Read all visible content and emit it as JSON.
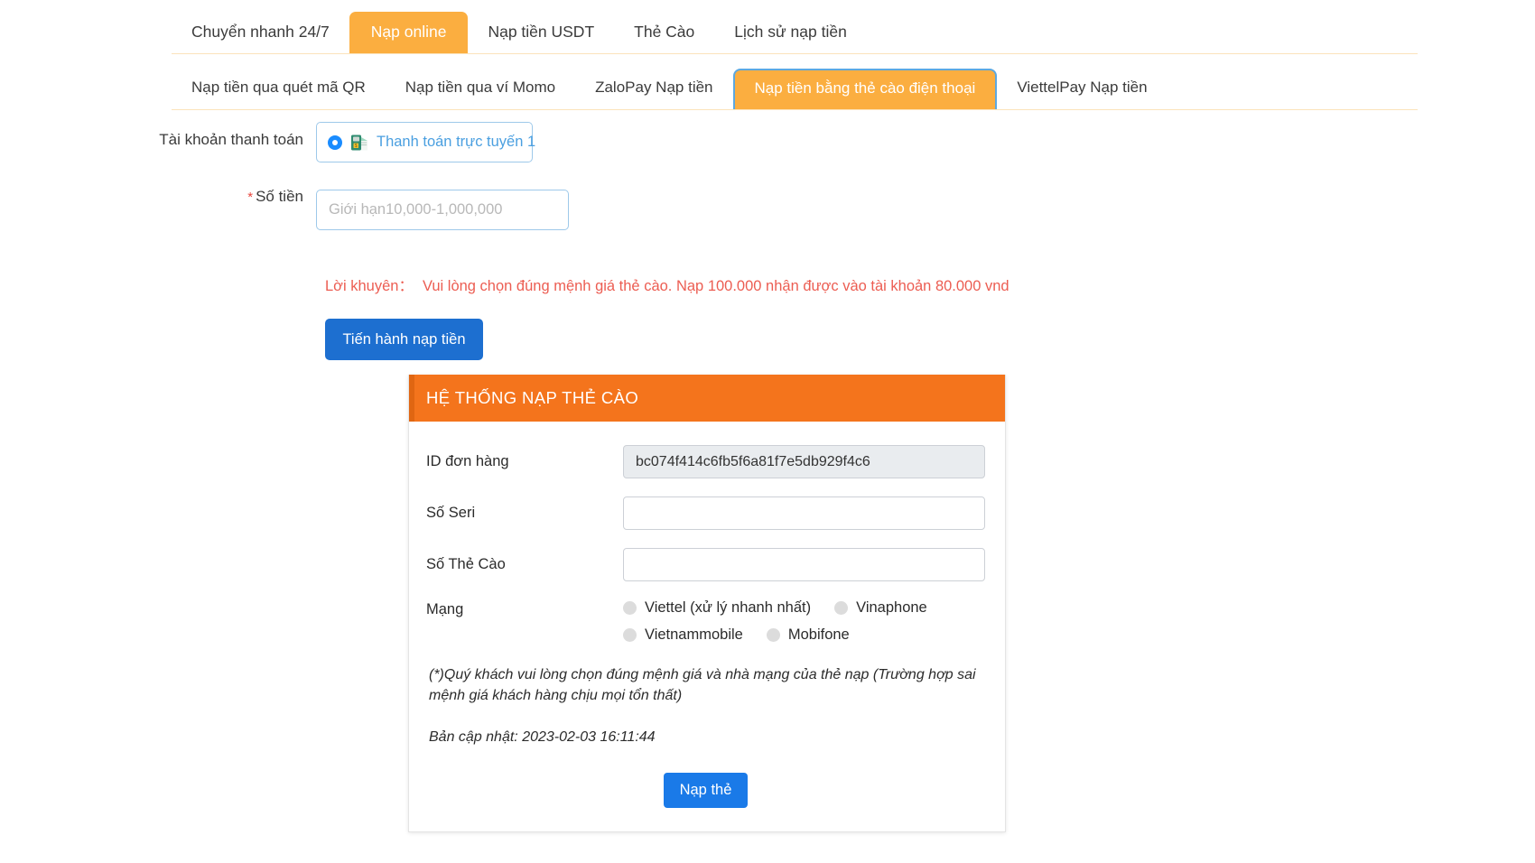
{
  "tabs_primary": [
    {
      "label": "Chuyển nhanh 24/7",
      "active": false
    },
    {
      "label": "Nạp online",
      "active": true
    },
    {
      "label": "Nạp tiền USDT",
      "active": false
    },
    {
      "label": "Thẻ Cào",
      "active": false
    },
    {
      "label": "Lịch sử nạp tiền",
      "active": false
    }
  ],
  "tabs_secondary": [
    {
      "label": "Nạp tiền qua quét mã QR",
      "active": false
    },
    {
      "label": "Nạp tiền qua ví Momo",
      "active": false
    },
    {
      "label": "ZaloPay Nạp tiền",
      "active": false
    },
    {
      "label": "Nạp tiền bằng thẻ cào điện thoại",
      "active": true
    },
    {
      "label": "ViettelPay Nạp tiền",
      "active": false
    }
  ],
  "form": {
    "account_label": "Tài khoản thanh toán",
    "account_option": "Thanh toán trực tuyến 1",
    "account_icon": "scratch-card-money-icon",
    "amount_label": "Số tiền",
    "amount_required_mark": "*",
    "amount_value": "",
    "amount_placeholder": "Giới hạn10,000-1,000,000",
    "advice_label": "Lời khuyên：",
    "advice_text": "Vui lòng chọn đúng mệnh giá thẻ cào. Nạp 100.000 nhận được vào tài khoản 80.000 vnd",
    "proceed_button": "Tiến hành nạp tiền"
  },
  "panel": {
    "title": "HỆ THỐNG NẠP THẺ CÀO",
    "fields": [
      {
        "label": "ID đơn hàng",
        "value": "bc074f414c6fb5f6a81f7e5db929f4c6",
        "readonly": true
      },
      {
        "label": "Số Seri",
        "value": "",
        "readonly": false
      },
      {
        "label": "Số Thẻ Cào",
        "value": "",
        "readonly": false
      }
    ],
    "network_label": "Mạng",
    "network_options": [
      {
        "label": "Viettel (xử lý nhanh nhất)",
        "selected": false
      },
      {
        "label": "Vinaphone",
        "selected": false
      },
      {
        "label": "Vietnammobile",
        "selected": false
      },
      {
        "label": "Mobifone",
        "selected": false
      }
    ],
    "note": "(*)Quý khách vui lòng chọn đúng mệnh giá và nhà mạng của thẻ nạp (Trường hợp sai mệnh giá khách hàng chịu mọi tổn thất)",
    "updated": "Bản cập nhật: 2023-02-03 16:11:44",
    "submit_button": "Nạp thẻ"
  },
  "colors": {
    "tab_active_bg": "#FBAE40",
    "tab_active_border": "#5DA8E0",
    "panel_header_bg": "#F4741C",
    "primary_button": "#1D6FD0",
    "submit_button": "#1A7AE8",
    "advice_text": "#EC5D52",
    "link_blue": "#4A9FE0"
  }
}
